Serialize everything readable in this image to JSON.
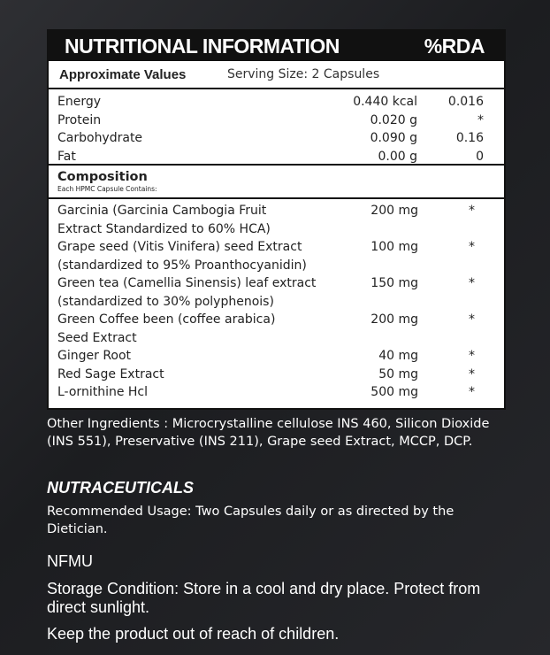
{
  "header": {
    "title": "NUTRITIONAL INFORMATION",
    "rda": "%RDA"
  },
  "subheader": {
    "approx": "Approximate Values",
    "serving": "Serving Size: 2 Capsules"
  },
  "nutrition": [
    {
      "name": "Energy",
      "amount": "0.440 kcal",
      "rda": "0.016"
    },
    {
      "name": "Protein",
      "amount": "0.020 g",
      "rda": "*"
    },
    {
      "name": "Carbohydrate",
      "amount": "0.090 g",
      "rda": "0.16"
    },
    {
      "name": "Fat",
      "amount": "0.00 g",
      "rda": "0"
    }
  ],
  "composition": {
    "title": "Composition",
    "subtitle": "Each HPMC Capsule Contains:",
    "items": [
      {
        "line1": "Garcinia (Garcinia Cambogia Fruit",
        "line2": "Extract Standardized to 60% HCA)",
        "amount": "200 mg",
        "rda": "*"
      },
      {
        "line1": "Grape seed (Vitis Vinifera) seed Extract",
        "line2": "(standardized to 95% Proanthocyanidin)",
        "amount": "100 mg",
        "rda": "*"
      },
      {
        "line1": "Green tea (Camellia Sinensis) leaf extract",
        "line2": "(standardized to 30% polyphenois)",
        "amount": "150 mg",
        "rda": "*"
      },
      {
        "line1": "Green Coffee been (coffee arabica)",
        "line2": "Seed Extract",
        "amount": "200 mg",
        "rda": "*"
      },
      {
        "line1": "Ginger Root",
        "amount": "40 mg",
        "rda": "*"
      },
      {
        "line1": "Red Sage Extract",
        "amount": "50 mg",
        "rda": "*"
      },
      {
        "line1": "L-ornithine Hcl",
        "amount": "500 mg",
        "rda": "*"
      }
    ]
  },
  "other_ingredients": "Other Ingredients : Microcrystalline cellulose INS 460, Silicon Dioxide (INS 551), Preservative (INS 211), Grape seed Extract, MCCP, DCP.",
  "brand": "NUTRACEUTICALS",
  "usage": "Recommended Usage: Two Capsules daily or as directed by the Dietician.",
  "code": "NFMU",
  "storage": "Storage Condition: Store in a cool and dry place. Protect from direct sunlight.",
  "keep": "Keep the product out of reach of children."
}
